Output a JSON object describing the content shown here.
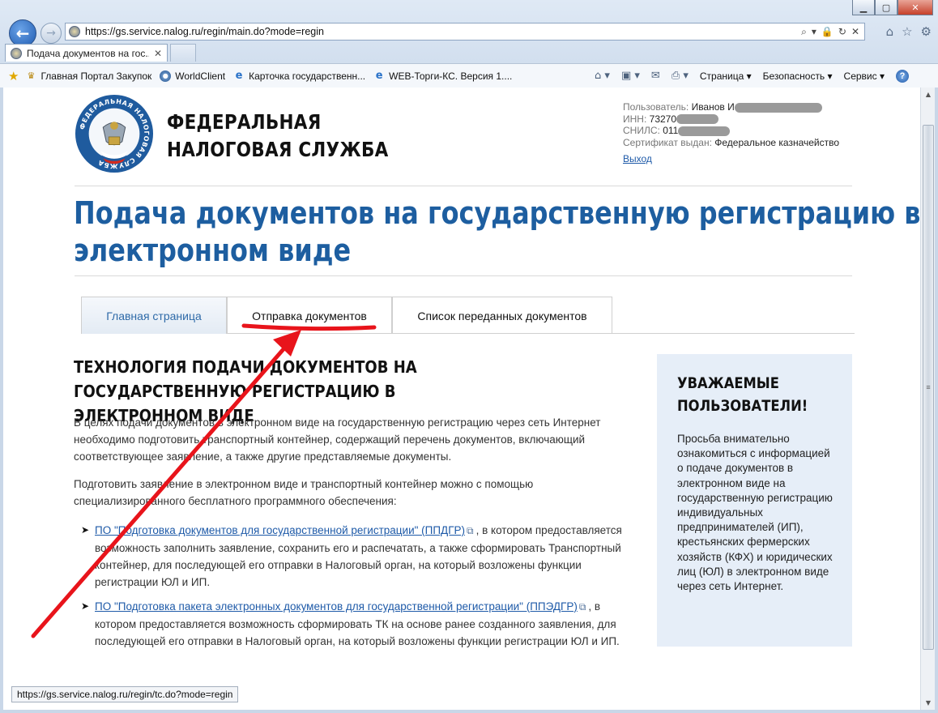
{
  "browser": {
    "url": "https://gs.service.nalog.ru/regin/main.do?mode=regin",
    "tab_title": "Подача документов на гос...",
    "tab_close": "✕",
    "window_buttons": {
      "minimize": "▁",
      "maximize": "▢",
      "close": "✕"
    },
    "address_tools": [
      "⌕",
      "▾",
      "🔒",
      "↻",
      "✕"
    ],
    "right_tools": [
      "⌂",
      "☆",
      "⚙"
    ],
    "favorites": [
      {
        "label": "Главная Портал Закупок",
        "icon": "emblem-icon"
      },
      {
        "label": "WorldClient",
        "icon": "globe-icon"
      },
      {
        "label": "Карточка государственн...",
        "icon": "ie-icon"
      },
      {
        "label": "WEB-Торги-КС. Версия 1....",
        "icon": "ie-icon"
      }
    ],
    "command_menus": [
      "Страница ▾",
      "Безопасность ▾",
      "Сервис ▾"
    ],
    "help_glyph": "?",
    "status_url": "https://gs.service.nalog.ru/regin/tc.do?mode=regin"
  },
  "header": {
    "org_line1": "ФЕДЕРАЛЬНАЯ",
    "org_line2": "НАЛОГОВАЯ СЛУЖБА",
    "logo_ring_text": "ФЕДЕРАЛЬНАЯ НАЛОГОВАЯ СЛУЖБА"
  },
  "user": {
    "user_label": "Пользователь:",
    "user_value": "Иванов И",
    "inn_label": "ИНН:",
    "inn_value": "73270",
    "snils_label": "СНИЛС:",
    "snils_value": "011",
    "cert_label": "Сертификат выдан:",
    "cert_value": "Федеральное казначейство",
    "logout": "Выход"
  },
  "page": {
    "title_line1": "Подача документов на государственную регистрацию в",
    "title_line2": "электронном виде"
  },
  "tabs": {
    "main": "Главная страница",
    "send": "Отправка документов",
    "list": "Список переданных документов"
  },
  "content": {
    "section_title_line1": "ТЕХНОЛОГИЯ ПОДАЧИ ДОКУМЕНТОВ НА ГОСУДАРСТВЕННУЮ РЕГИСТРАЦИЮ В",
    "section_title_line2": "ЭЛЕКТРОННОМ ВИДЕ",
    "para1": "В целях подачи документов в электронном виде на государственную регистрацию через сеть Интернет необходимо подготовить транспортный контейнер, содержащий перечень документов, включающий соответствующее заявление, а также другие представляемые документы.",
    "para2": "Подготовить заявление в электронном виде и транспортный контейнер можно с помощью специализированного бесплатного программного обеспечения:",
    "bullets": [
      {
        "link": "ПО \"Подготовка документов для государственной регистрации\" (ППДГР)",
        "text": ", в котором предоставляется возможность заполнить заявление, сохранить его и распечатать, а также сформировать Транспортный контейнер, для последующей его отправки в Налоговый орган, на который возложены функции регистрации ЮЛ и ИП."
      },
      {
        "link": "ПО \"Подготовка пакета электронных документов для государственной регистрации\" (ППЭДГР)",
        "text": ", в котором предоставляется возможность сформировать ТК на основе ранее созданного заявления, для последующей его отправки в Налоговый орган, на который возложены функции регистрации ЮЛ и ИП."
      }
    ],
    "bullet_glyph": "➤",
    "ext_glyph": "⧉"
  },
  "notice": {
    "title": "УВАЖАЕМЫЕ ПОЛЬЗОВАТЕЛИ!",
    "text": "Просьба внимательно ознакомиться с информацией о подаче документов в электронном виде на государственную регистрацию индивидуальных предпринимателей (ИП), крестьянских фермерских хозяйств (КФХ) и юридических лиц (ЮЛ) в электронном виде через сеть Интернет."
  },
  "colors": {
    "brand_blue": "#1d5ea0",
    "link": "#1e5aa8",
    "annotation_red": "#e8141b",
    "notice_bg": "#e6eef8"
  }
}
